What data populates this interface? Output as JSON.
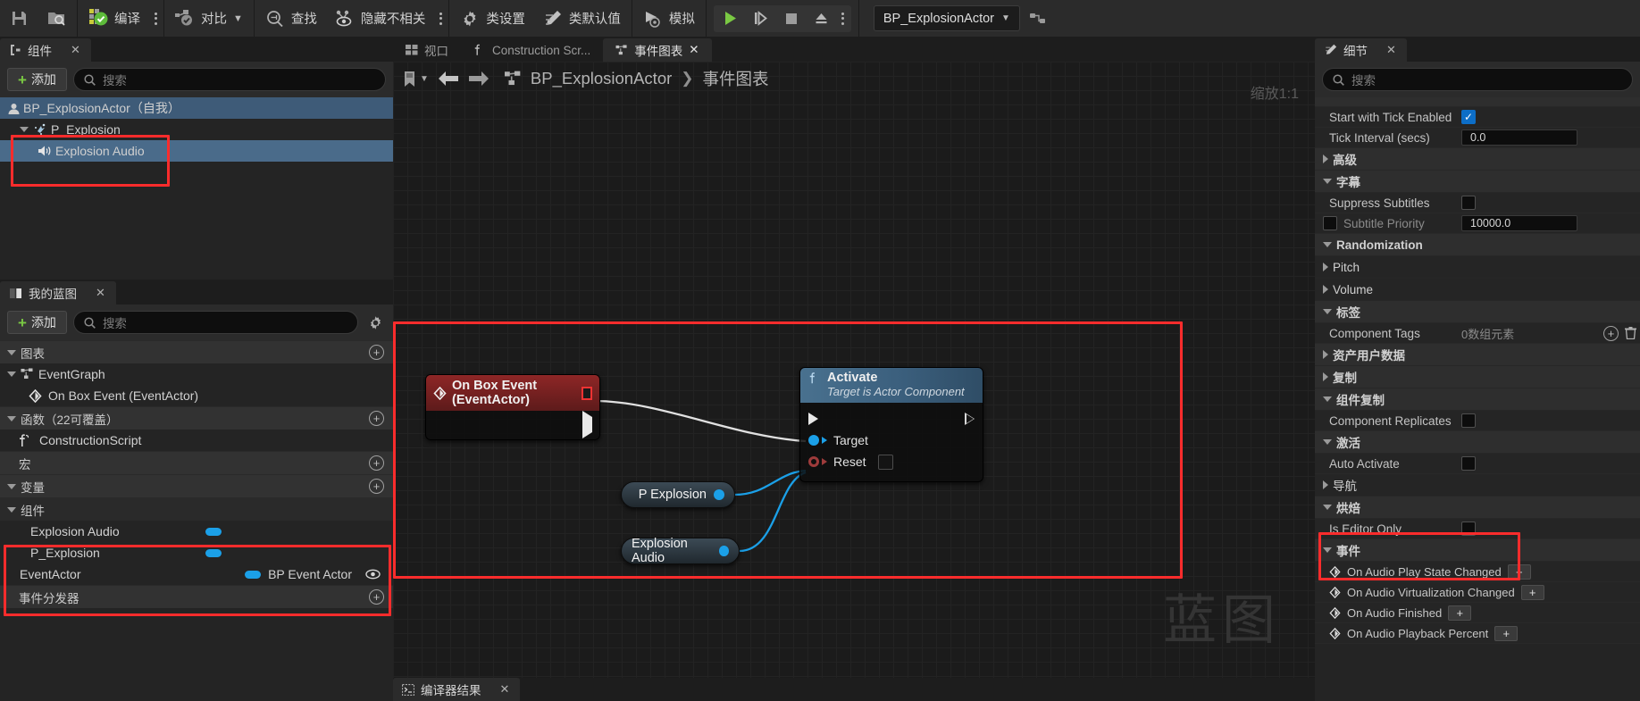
{
  "toolbar": {
    "save_icon": "save-icon",
    "browse_icon": "browse-folder-icon",
    "compile": "编译",
    "diff": "对比",
    "find": "查找",
    "hide_unrelated": "隐藏不相关",
    "class_settings": "类设置",
    "class_defaults": "类默认值",
    "simulate": "模拟",
    "play_icon": "play-icon",
    "step_icon": "step-icon",
    "stop_icon": "stop-icon",
    "eject_icon": "eject-icon",
    "blueprint_combo": "BP_ExplosionActor",
    "debug_filter_icon": "debug-object-icon"
  },
  "components_panel": {
    "tab_label": "组件",
    "add_label": "添加",
    "search_placeholder": "搜索",
    "tree": [
      {
        "label": "BP_ExplosionActor（自我）",
        "icon": "actor-icon",
        "indent": 0,
        "selected": true
      },
      {
        "label": "P_Explosion",
        "icon": "particle-icon",
        "indent": 1,
        "selected": false
      },
      {
        "label": "Explosion Audio",
        "icon": "audio-icon",
        "indent": 2,
        "selected": true
      }
    ]
  },
  "my_blueprint_panel": {
    "tab_label": "我的蓝图",
    "add_label": "添加",
    "search_placeholder": "搜索",
    "gear_icon": "gear-icon",
    "sections": [
      {
        "label": "图表",
        "expanded": true,
        "items": [
          {
            "label": "EventGraph",
            "icon": "graph-icon",
            "indent": 1,
            "expandable": true
          },
          {
            "label": "On Box Event (EventActor)",
            "icon": "event-icon",
            "indent": 2
          }
        ]
      },
      {
        "label": "函数（22可覆盖）",
        "expanded": true,
        "items": [
          {
            "label": "ConstructionScript",
            "icon": "function-icon",
            "indent": 1
          }
        ]
      },
      {
        "label": "宏",
        "expanded": false,
        "items": []
      },
      {
        "label": "变量",
        "expanded": true,
        "items": []
      }
    ],
    "components_group": {
      "label": "组件",
      "rows": [
        {
          "name": "Explosion Audio",
          "type": "",
          "indent": 2,
          "pill": true,
          "eye": false
        },
        {
          "name": "P_Explosion",
          "type": "",
          "indent": 2,
          "pill": true,
          "eye": false
        },
        {
          "name": "EventActor",
          "type": "BP Event Actor",
          "indent": 1,
          "pill": true,
          "eye": true
        }
      ]
    },
    "dispatchers_label": "事件分发器"
  },
  "graph": {
    "tabs": [
      {
        "label": "视口",
        "icon": "viewport-icon",
        "active": false,
        "closable": false
      },
      {
        "label": "Construction Scr...",
        "icon": "function-icon",
        "active": false,
        "closable": false
      },
      {
        "label": "事件图表",
        "icon": "graph-icon",
        "active": true,
        "closable": true
      }
    ],
    "breadcrumb_root": "BP_ExplosionActor",
    "breadcrumb_sep": "❯",
    "breadcrumb_leaf": "事件图表",
    "zoom_label": "缩放1:1",
    "watermark": "蓝图",
    "bookmark_icon": "bookmark-icon",
    "back_icon": "back-arrow-icon",
    "forward_icon": "forward-arrow-icon",
    "nodes": {
      "event": {
        "title": "On Box Event (EventActor)",
        "icon": "event-diamond-icon",
        "breakpoint_marker": "red-square-marker"
      },
      "activate": {
        "title": "Activate",
        "subtitle": "Target is Actor Component",
        "icon": "function-f-icon",
        "pins": [
          {
            "label": "Target",
            "kind": "object"
          },
          {
            "label": "Reset",
            "kind": "bool",
            "value": false
          }
        ]
      },
      "var_nodes": [
        {
          "label": "P Explosion"
        },
        {
          "label": "Explosion Audio"
        }
      ]
    },
    "bottom_tab": {
      "label": "编译器结果",
      "icon": "console-icon"
    }
  },
  "details_panel": {
    "tab_label": "细节",
    "search_placeholder": "搜索",
    "pencil_icon": "pencil-icon",
    "rows": [
      {
        "kind": "prop",
        "name": "Start with Tick Enabled",
        "ctrl": "checkbox",
        "checked": true
      },
      {
        "kind": "prop",
        "name": "Tick Interval (secs)",
        "ctrl": "number",
        "value": "0.0"
      },
      {
        "kind": "cat",
        "name": "高级",
        "expanded": false
      },
      {
        "kind": "cat",
        "name": "字幕",
        "expanded": true
      },
      {
        "kind": "prop",
        "name": "Suppress Subtitles",
        "ctrl": "checkbox",
        "checked": false
      },
      {
        "kind": "prop",
        "name": "Subtitle Priority",
        "ctrl": "number",
        "value": "10000.0",
        "dim": true,
        "lead_checkbox": true
      },
      {
        "kind": "cat",
        "name": "Randomization",
        "expanded": true
      },
      {
        "kind": "cat",
        "name": "Pitch",
        "expanded": false,
        "sub": true
      },
      {
        "kind": "cat",
        "name": "Volume",
        "expanded": false,
        "sub": true
      },
      {
        "kind": "cat",
        "name": "标签",
        "expanded": true
      },
      {
        "kind": "prop",
        "name": "Component Tags",
        "ctrl": "array",
        "value": "0数组元素"
      },
      {
        "kind": "cat",
        "name": "资产用户数据",
        "expanded": false
      },
      {
        "kind": "cat",
        "name": "复制",
        "expanded": false
      },
      {
        "kind": "cat",
        "name": "组件复制",
        "expanded": true
      },
      {
        "kind": "prop",
        "name": "Component Replicates",
        "ctrl": "checkbox",
        "checked": false
      },
      {
        "kind": "cat",
        "name": "激活",
        "expanded": true
      },
      {
        "kind": "prop",
        "name": "Auto Activate",
        "ctrl": "checkbox",
        "checked": false
      },
      {
        "kind": "cat",
        "name": "导航",
        "expanded": false
      },
      {
        "kind": "cat",
        "name": "烘焙",
        "expanded": true
      },
      {
        "kind": "prop",
        "name": "Is Editor Only",
        "ctrl": "checkbox",
        "checked": false
      },
      {
        "kind": "cat",
        "name": "事件",
        "expanded": true
      },
      {
        "kind": "event",
        "name": "On Audio Play State Changed",
        "btn": "+"
      },
      {
        "kind": "event",
        "name": "On Audio Virtualization Changed",
        "btn": "+"
      },
      {
        "kind": "event",
        "name": "On Audio Finished",
        "btn": "+"
      },
      {
        "kind": "event",
        "name": "On Audio Playback Percent",
        "btn": "+"
      }
    ],
    "array_add_icon": "circle-plus-icon",
    "array_del_icon": "trash-icon"
  },
  "colors": {
    "accent_blue": "#1ba0e8",
    "highlight_red": "#fb2c2c",
    "green": "#7ac943",
    "panel_bg": "#242424",
    "selection": "#3e5b78"
  }
}
